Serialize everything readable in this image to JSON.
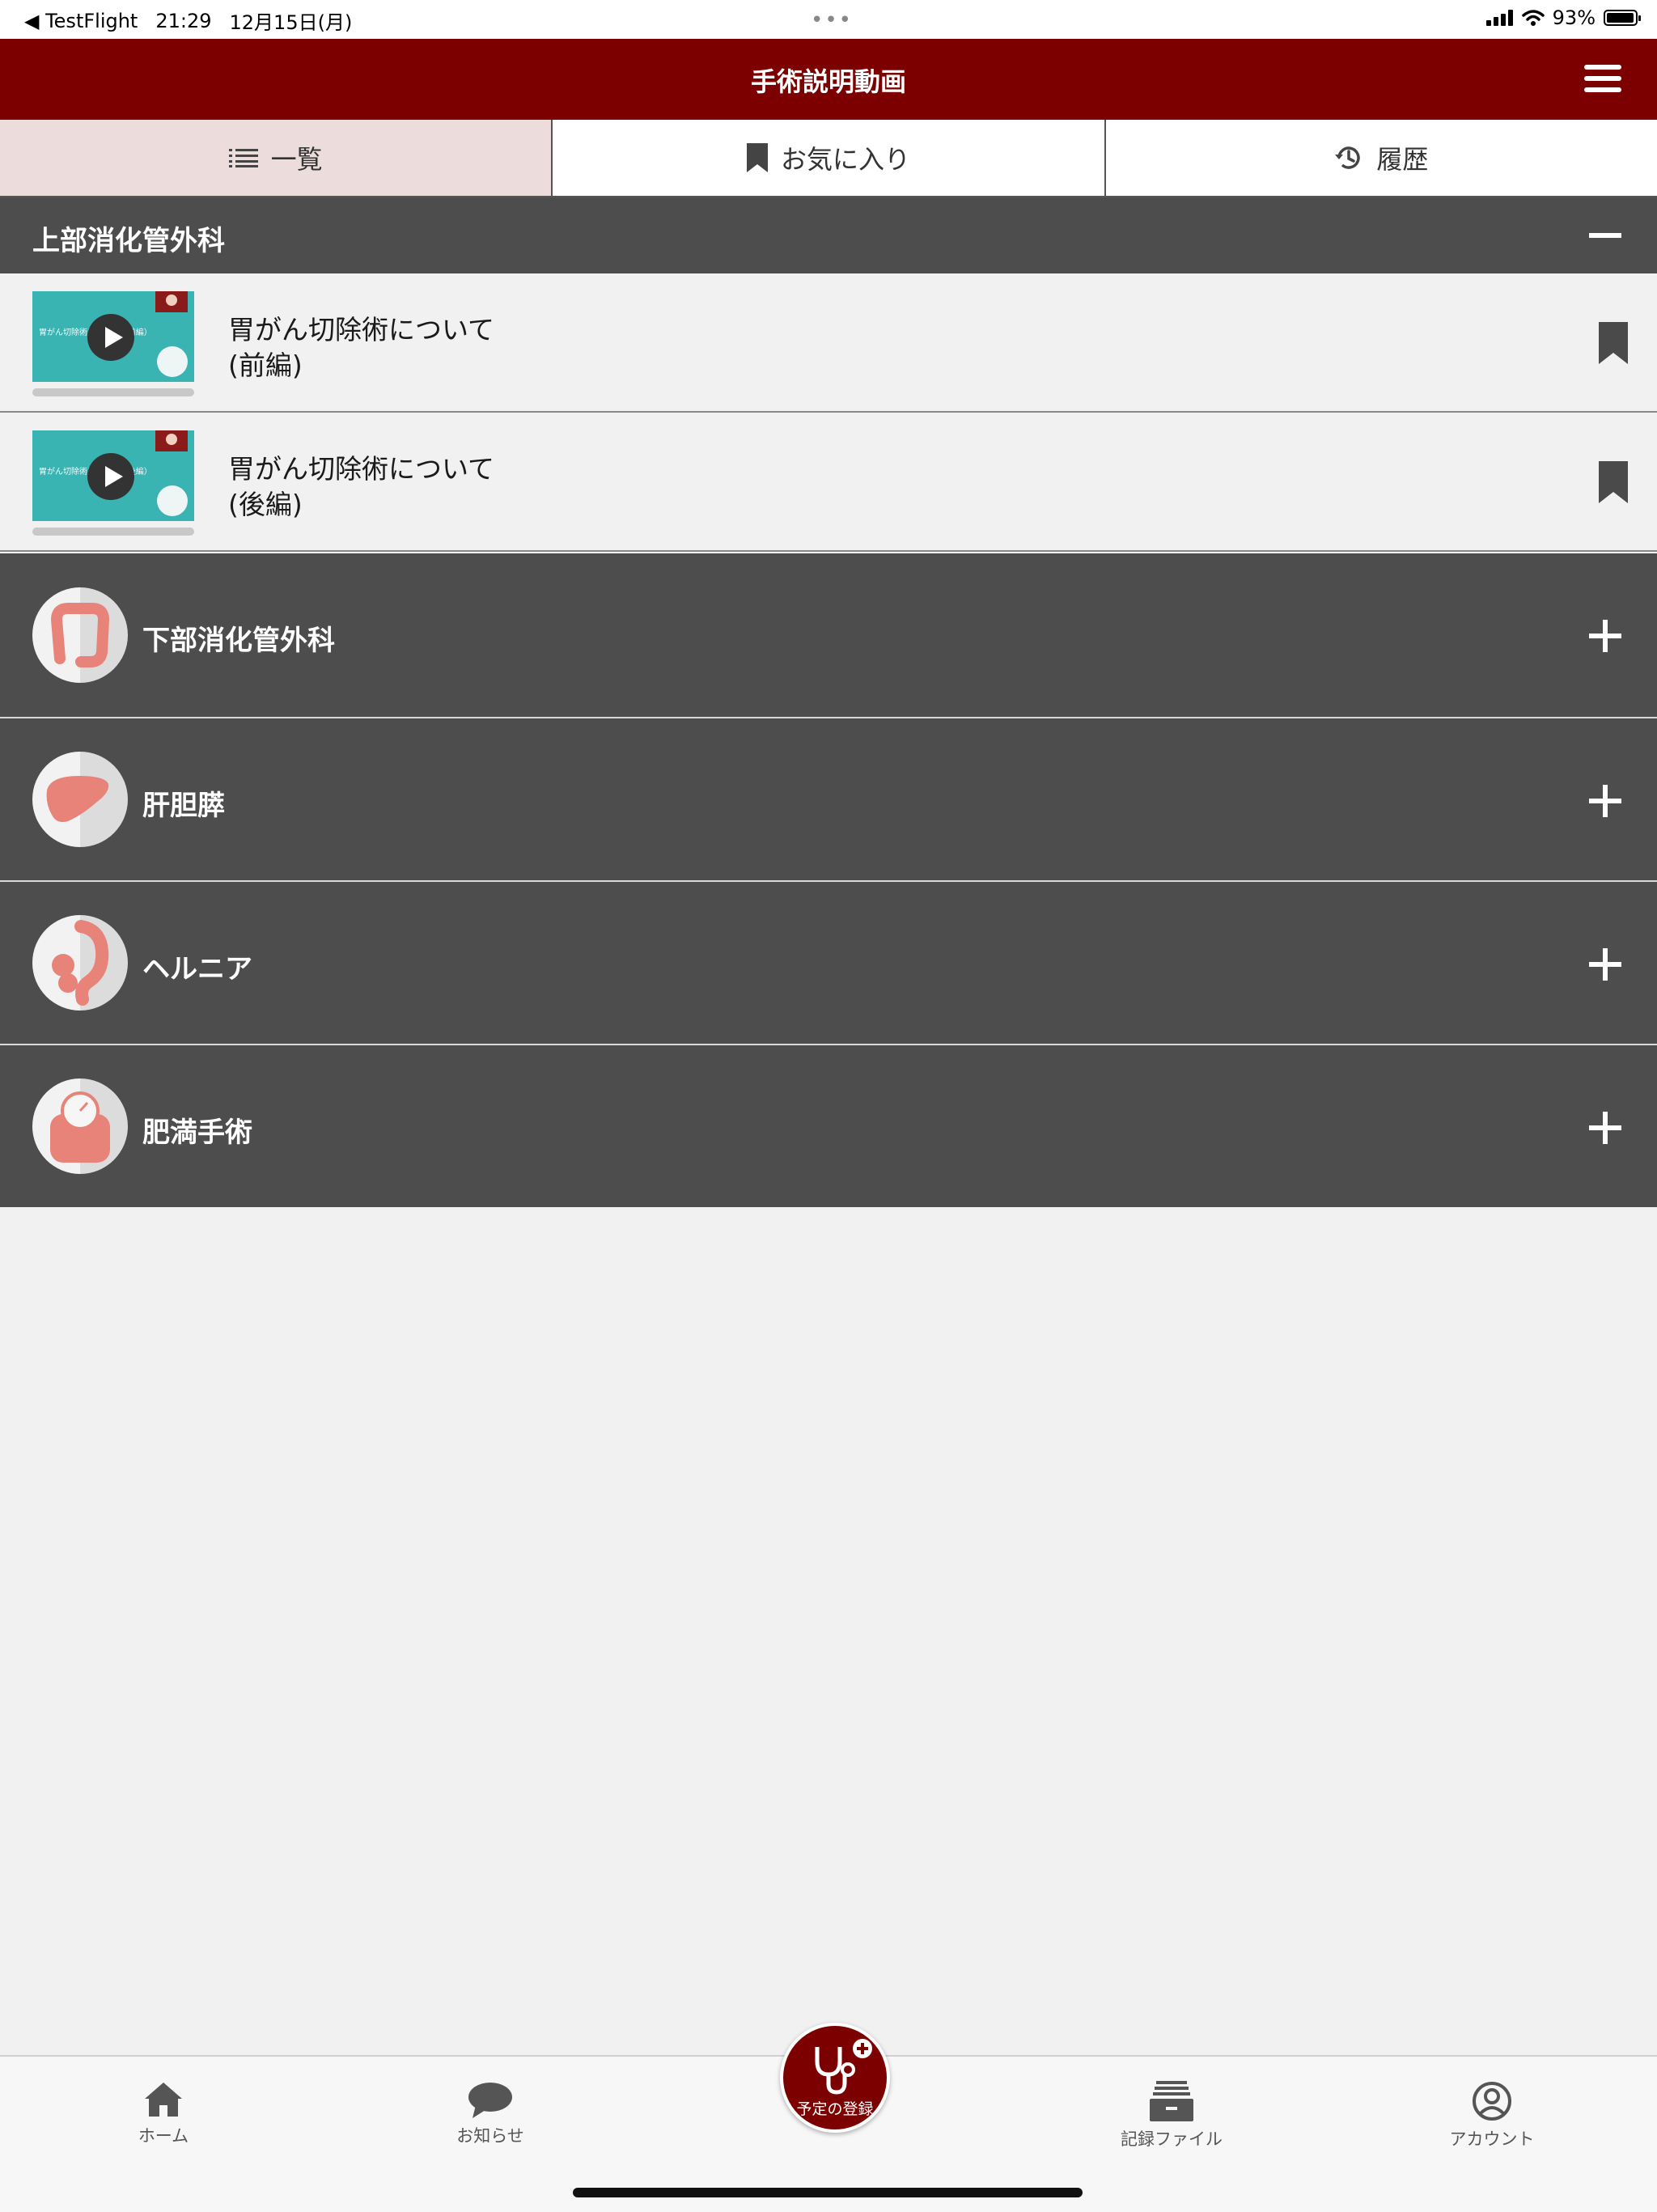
{
  "status_bar": {
    "back_app": "◀ TestFlight",
    "time": "21:29",
    "date": "12月15日(月)",
    "dots": "•••",
    "battery": "93%"
  },
  "header": {
    "title": "手術説明動画",
    "menu_icon": "hamburger-icon"
  },
  "tabs": [
    {
      "label": "一覧",
      "icon": "list-icon",
      "active": true
    },
    {
      "label": "お気に入り",
      "icon": "bookmark-icon",
      "active": false
    },
    {
      "label": "履歴",
      "icon": "history-icon",
      "active": false
    }
  ],
  "sections": [
    {
      "name": "上部消化管外科",
      "expanded": true,
      "videos": [
        {
          "title_line1": "胃がん切除術について",
          "title_line2": "(前編)",
          "thumb_caption": "胃がん切除術について（前編）"
        },
        {
          "title_line1": "胃がん切除術について",
          "title_line2": "(後編)",
          "thumb_caption": "胃がん切除術について（後編）"
        }
      ]
    },
    {
      "name": "下部消化管外科",
      "expanded": false,
      "icon": "colon-icon"
    },
    {
      "name": "肝胆膵",
      "expanded": false,
      "icon": "liver-icon"
    },
    {
      "name": "ヘルニア",
      "expanded": false,
      "icon": "hernia-icon"
    },
    {
      "name": "肥満手術",
      "expanded": false,
      "icon": "scale-icon"
    }
  ],
  "bottom_nav": {
    "items": [
      {
        "label": "ホーム",
        "icon": "home-icon"
      },
      {
        "label": "お知らせ",
        "icon": "chat-bubble-icon"
      },
      {
        "label": "記録ファイル",
        "icon": "file-box-icon"
      },
      {
        "label": "アカウント",
        "icon": "account-icon"
      }
    ],
    "fab": {
      "label": "予定の登録",
      "icon": "stethoscope-plus-icon"
    }
  },
  "colors": {
    "brand": "#7c0000",
    "section_bg": "#4d4d4d",
    "active_tab_bg": "#ecdcdc",
    "thumbnail": "#3ab3b3",
    "organ_pink": "#e8837a"
  }
}
